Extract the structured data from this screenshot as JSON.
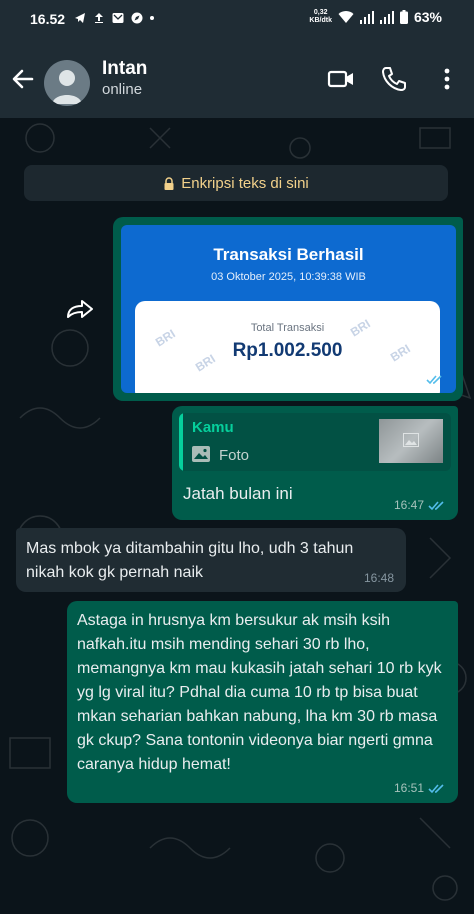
{
  "status_bar": {
    "time": "16.52",
    "net_speed_value": "0,32",
    "net_speed_unit": "KB/dtk",
    "battery": "63%"
  },
  "header": {
    "contact_name": "Intan",
    "contact_status": "online"
  },
  "chat": {
    "encryption_notice": "Enkripsi teks di sini",
    "messages": [
      {
        "direction": "outgoing",
        "type": "image",
        "receipt_title": "Transaksi Berhasil",
        "receipt_date": "03 Oktober 2025, 10:39:38 WIB",
        "receipt_total_label": "Total Transaksi",
        "receipt_amount": "Rp1.002.500",
        "receipt_watermark": "BRI"
      },
      {
        "direction": "outgoing",
        "type": "reply",
        "quoted_author": "Kamu",
        "quoted_type": "Foto",
        "text": "Jatah bulan ini",
        "time": "16:47"
      },
      {
        "direction": "incoming",
        "type": "text",
        "text": "Mas mbok ya ditambahin gitu lho, udh 3 tahun nikah kok gk pernah naik",
        "time": "16:48"
      },
      {
        "direction": "outgoing",
        "type": "text",
        "text": "Astaga in hrusnya km bersukur ak msih ksih nafkah.itu msih mending sehari 30 rb lho, memangnya km mau kukasih jatah sehari 10 rb kyk yg lg viral itu? Pdhal dia cuma 10 rb tp bisa buat mkan seharian bahkan nabung, lha km 30 rb masa gk ckup? Sana tontonin videonya biar ngerti gmna caranya hidup hemat!",
        "time": "16:51"
      }
    ]
  },
  "colors": {
    "chat_background": "#0b141a",
    "header_background": "#1f2c34",
    "outgoing_bubble": "#005c4b",
    "incoming_bubble": "#202c33",
    "read_ticks": "#53bdeb",
    "encryption_text": "#f2d18b",
    "receipt_blue": "#0d6ad0"
  },
  "icons": [
    "back-arrow-icon",
    "avatar",
    "video-call-icon",
    "voice-call-icon",
    "more-options-icon",
    "lock-icon",
    "forward-icon",
    "photo-icon",
    "read-ticks-icon",
    "wifi-icon",
    "signal-icon",
    "battery-icon"
  ]
}
